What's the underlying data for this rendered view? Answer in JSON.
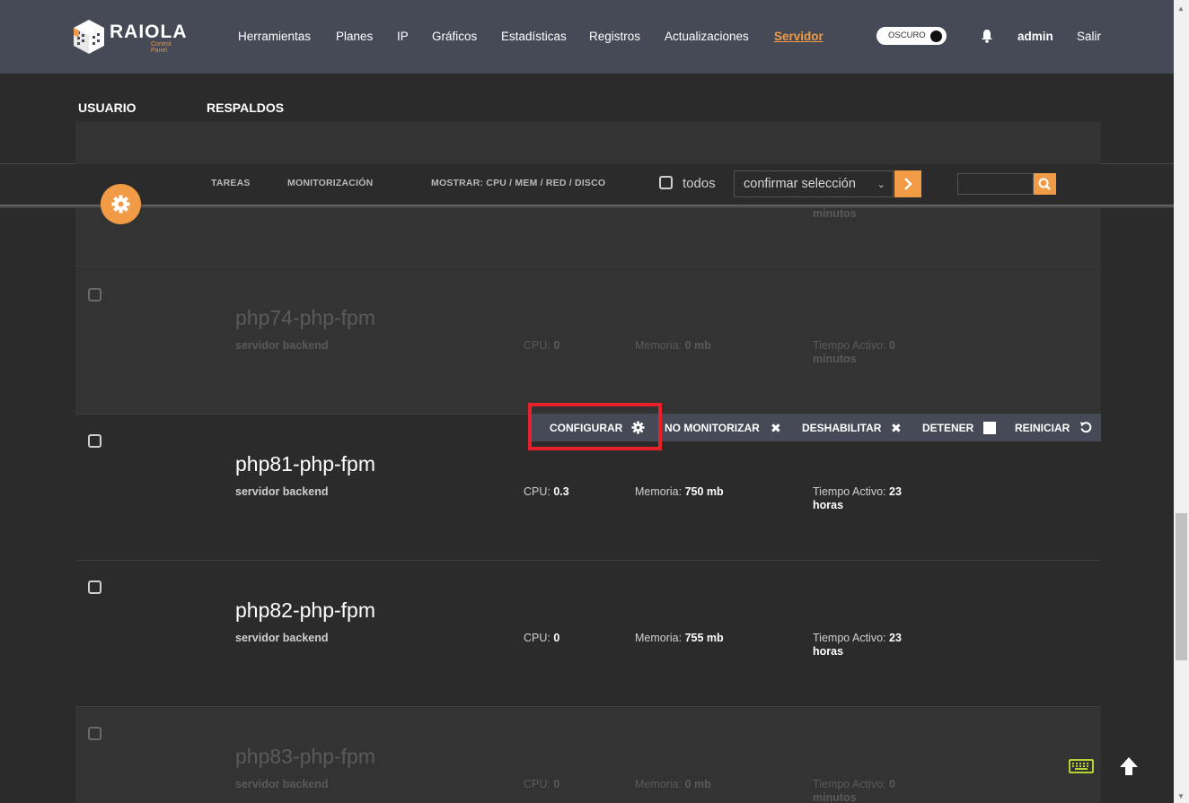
{
  "header": {
    "logo_text": "RAIOLA",
    "logo_sub": "Control Panel",
    "nav": [
      "Herramientas",
      "Planes",
      "IP",
      "Gráficos",
      "Estadísticas",
      "Registros",
      "Actualizaciones",
      "Servidor"
    ],
    "active_nav": "Servidor",
    "theme_toggle": "OSCURO",
    "user": "admin",
    "logout": "Salir"
  },
  "subtabs": [
    "USUARIO",
    "RESPALDOS"
  ],
  "toolbar": {
    "tasks": "TAREAS",
    "monitoring": "MONITORIZACIÓN",
    "show": "MOSTRAR: CPU / MEM / RED / DISCO",
    "all_label": "todos",
    "select_value": "confirmar selección"
  },
  "partial_row_text": "minutos",
  "services": [
    {
      "name": "php74-php-fpm",
      "type": "servidor backend",
      "cpu_label": "CPU:",
      "cpu": "0",
      "mem_label": "Memoria:",
      "mem": "0 mb",
      "uptime_label": "Tiempo Activo:",
      "uptime_a": "0",
      "uptime_b": "minutos"
    },
    {
      "name": "php81-php-fpm",
      "type": "servidor backend",
      "cpu_label": "CPU:",
      "cpu": "0.3",
      "mem_label": "Memoria:",
      "mem": "750 mb",
      "uptime_label": "Tiempo Activo:",
      "uptime_a": "23",
      "uptime_b": "horas"
    },
    {
      "name": "php82-php-fpm",
      "type": "servidor backend",
      "cpu_label": "CPU:",
      "cpu": "0",
      "mem_label": "Memoria:",
      "mem": "755 mb",
      "uptime_label": "Tiempo Activo:",
      "uptime_a": "23",
      "uptime_b": "horas"
    },
    {
      "name": "php83-php-fpm",
      "type": "servidor backend",
      "cpu_label": "CPU:",
      "cpu": "0",
      "mem_label": "Memoria:",
      "mem": "0 mb",
      "uptime_label": "Tiempo Activo:",
      "uptime_a": "0",
      "uptime_b": "minutos"
    }
  ],
  "actions": {
    "configure": "CONFIGURAR",
    "no_monitor": "NO MONITORIZAR",
    "disable": "DESHABILITAR",
    "stop": "DETENER",
    "restart": "REINICIAR"
  },
  "icons": {
    "accent": "#f29b46",
    "highlight": "#e8202a"
  }
}
